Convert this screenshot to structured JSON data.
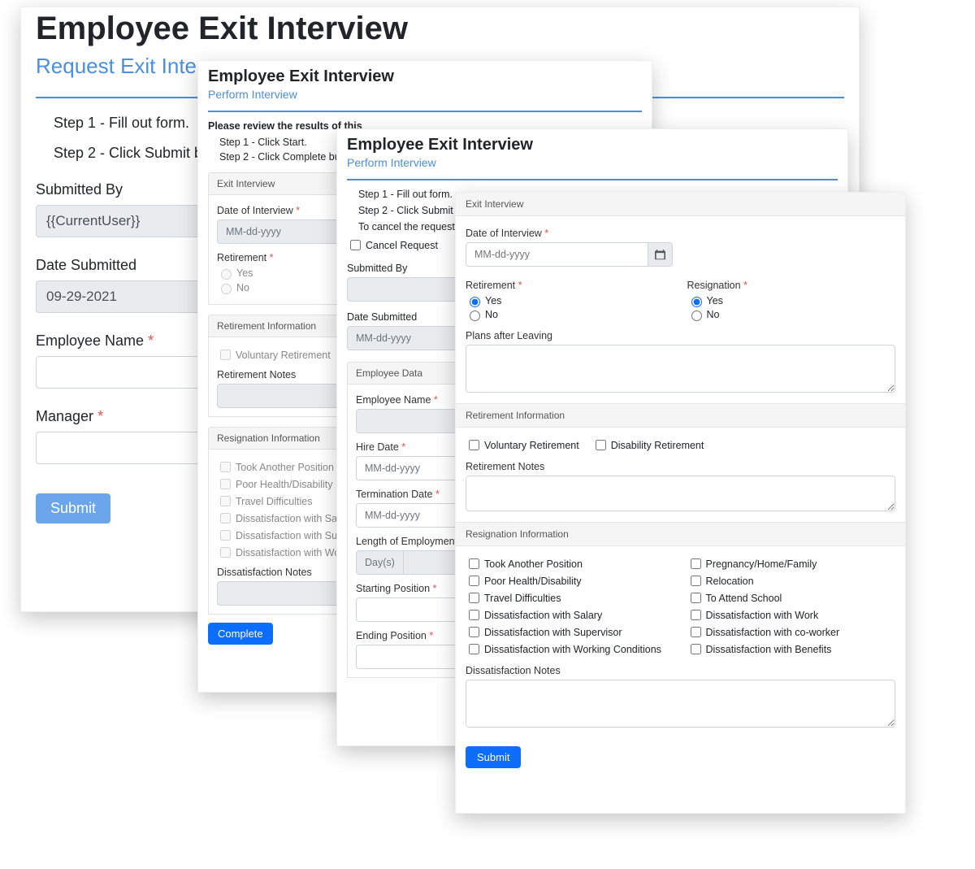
{
  "card1": {
    "title": "Employee Exit Interview",
    "subtitle": "Request Exit Inter",
    "step1": "Step 1 - Fill out form.",
    "step2": "Step 2 - Click Submit bu",
    "submitted_by_label": "Submitted By",
    "submitted_by_value": "{{CurrentUser}}",
    "date_submitted_label": "Date Submitted",
    "date_submitted_value": "09-29-2021",
    "employee_name_label": "Employee Name",
    "manager_label": "Manager",
    "submit": "Submit"
  },
  "card2": {
    "title": "Employee Exit Interview",
    "subtitle": "Perform Interview",
    "lead": "Please review the results of this",
    "step1": "Step 1 - Click Start.",
    "step2": "Step 2 - Click Complete butto",
    "exit_header": "Exit Interview",
    "date_label": "Date of Interview",
    "date_placeholder": "MM-dd-yyyy",
    "retirement_label": "Retirement",
    "yes": "Yes",
    "no": "No",
    "ret_info_header": "Retirement Information",
    "voluntary": "Voluntary Retirement",
    "ret_notes_label": "Retirement Notes",
    "res_info_header": "Resignation Information",
    "res_options": [
      "Took Another Position",
      "Poor Health/Disability",
      "Travel Difficulties",
      "Dissatisfaction with Salary",
      "Dissatisfaction with Supervisor",
      "Dissatisfaction with Working Con"
    ],
    "diss_notes_label": "Dissatisfaction Notes",
    "complete": "Complete"
  },
  "card3": {
    "title": "Employee Exit Interview",
    "subtitle": "Perform Interview",
    "step1": "Step 1 - Fill out form.",
    "step2": "Step 2 - Click Submit butto",
    "step3": "To cancel the request selec",
    "cancel_label": "Cancel Request",
    "submitted_by_label": "Submitted By",
    "date_submitted_label": "Date Submitted",
    "date_submitted_placeholder": "MM-dd-yyyy",
    "emp_data_header": "Employee Data",
    "emp_name_label": "Employee Name",
    "hire_date_label": "Hire Date",
    "hire_date_placeholder": "MM-dd-yyyy",
    "term_date_label": "Termination Date",
    "term_date_placeholder": "MM-dd-yyyy",
    "len_label": "Length of Employment",
    "len_unit": "Day(s)",
    "start_pos_label": "Starting Position",
    "end_pos_label": "Ending Position"
  },
  "card4": {
    "exit_header": "Exit Interview",
    "date_label": "Date of Interview",
    "date_placeholder": "MM-dd-yyyy",
    "retirement_label": "Retirement",
    "resignation_label": "Resignation",
    "yes": "Yes",
    "no": "No",
    "plans_label": "Plans after Leaving",
    "ret_info_header": "Retirement Information",
    "voluntary": "Voluntary Retirement",
    "disability": "Disability Retirement",
    "ret_notes_label": "Retirement Notes",
    "res_info_header": "Resignation Information",
    "res_col1": [
      "Took Another Position",
      "Poor Health/Disability",
      "Travel Difficulties",
      "Dissatisfaction with Salary",
      "Dissatisfaction with Supervisor",
      "Dissatisfaction with Working Conditions"
    ],
    "res_col2": [
      "Pregnancy/Home/Family",
      "Relocation",
      "To Attend School",
      "Dissatisfaction with Work",
      "Dissatisfaction with co-worker",
      "Dissatisfaction with Benefits"
    ],
    "diss_notes_label": "Dissatisfaction Notes",
    "submit": "Submit"
  }
}
